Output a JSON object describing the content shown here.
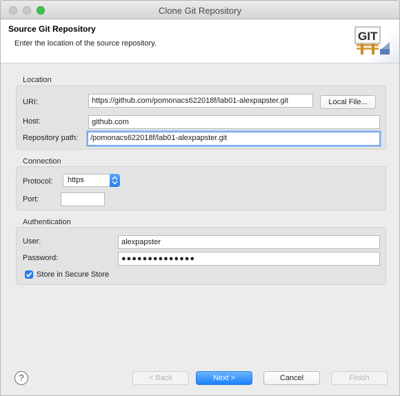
{
  "window": {
    "title": "Clone Git Repository"
  },
  "header": {
    "title": "Source Git Repository",
    "description": "Enter the location of the source repository.",
    "logo_text": "GIT"
  },
  "location": {
    "label": "Location",
    "uri_label": "URI:",
    "uri_value": "https://github.com/pomonacs622018f/lab01-alexpapster.git",
    "local_file_button": "Local File...",
    "host_label": "Host:",
    "host_value": "github.com",
    "repo_path_label": "Repository path:",
    "repo_path_value": "/pomonacs622018f/lab01-alexpapster.git"
  },
  "connection": {
    "label": "Connection",
    "protocol_label": "Protocol:",
    "protocol_value": "https",
    "port_label": "Port:",
    "port_value": ""
  },
  "authentication": {
    "label": "Authentication",
    "user_label": "User:",
    "user_value": "alexpapster",
    "password_label": "Password:",
    "password_value": "●●●●●●●●●●●●●●",
    "store_label": "Store in Secure Store",
    "store_checked": true
  },
  "footer": {
    "help_icon": "?",
    "back_button": "< Back",
    "next_button": "Next >",
    "cancel_button": "Cancel",
    "finish_button": "Finish"
  },
  "colors": {
    "accent": "#1a82fb",
    "focus": "#7aa9ec",
    "logo_green": "#3aa33a"
  },
  "icons": [
    "window-close-icon",
    "window-minimize-icon",
    "window-maximize-icon",
    "git-logo-icon",
    "checkmark-icon",
    "select-arrows-icon",
    "help-icon"
  ]
}
